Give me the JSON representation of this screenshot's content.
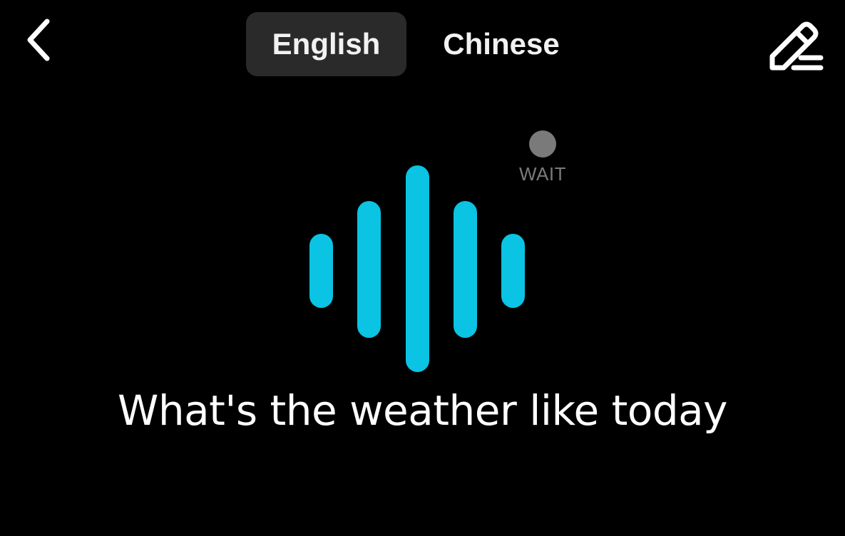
{
  "header": {
    "back_icon": "chevron-left-icon",
    "tabs": [
      {
        "label": "English",
        "active": true
      },
      {
        "label": "Chinese",
        "active": false
      }
    ],
    "edit_icon": "pencil-edit-icon"
  },
  "status": {
    "label": "WAIT",
    "color": "#7a7a7a"
  },
  "wave": {
    "icon": "voice-wave-icon",
    "color": "#0bc3e3"
  },
  "transcript": {
    "text": "What's the weather like today"
  }
}
